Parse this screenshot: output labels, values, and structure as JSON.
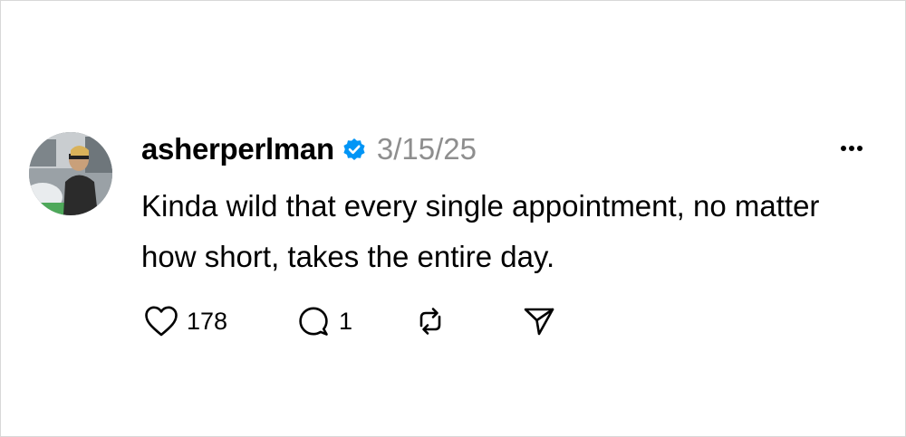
{
  "post": {
    "username": "asherperlman",
    "timestamp": "3/15/25",
    "text": "Kinda wild that every single appointment, no matter how short, takes the entire day.",
    "verified": true,
    "likes": "178",
    "replies": "1"
  },
  "icons": {
    "verified": "verified-badge-icon",
    "more": "more-options-icon",
    "like": "heart-icon",
    "reply": "comment-bubble-icon",
    "repost": "repost-icon",
    "share": "share-send-icon"
  },
  "colors": {
    "verified_badge": "#0095f6",
    "timestamp": "#8e8e8e",
    "text": "#000000",
    "icon": "#000000"
  }
}
